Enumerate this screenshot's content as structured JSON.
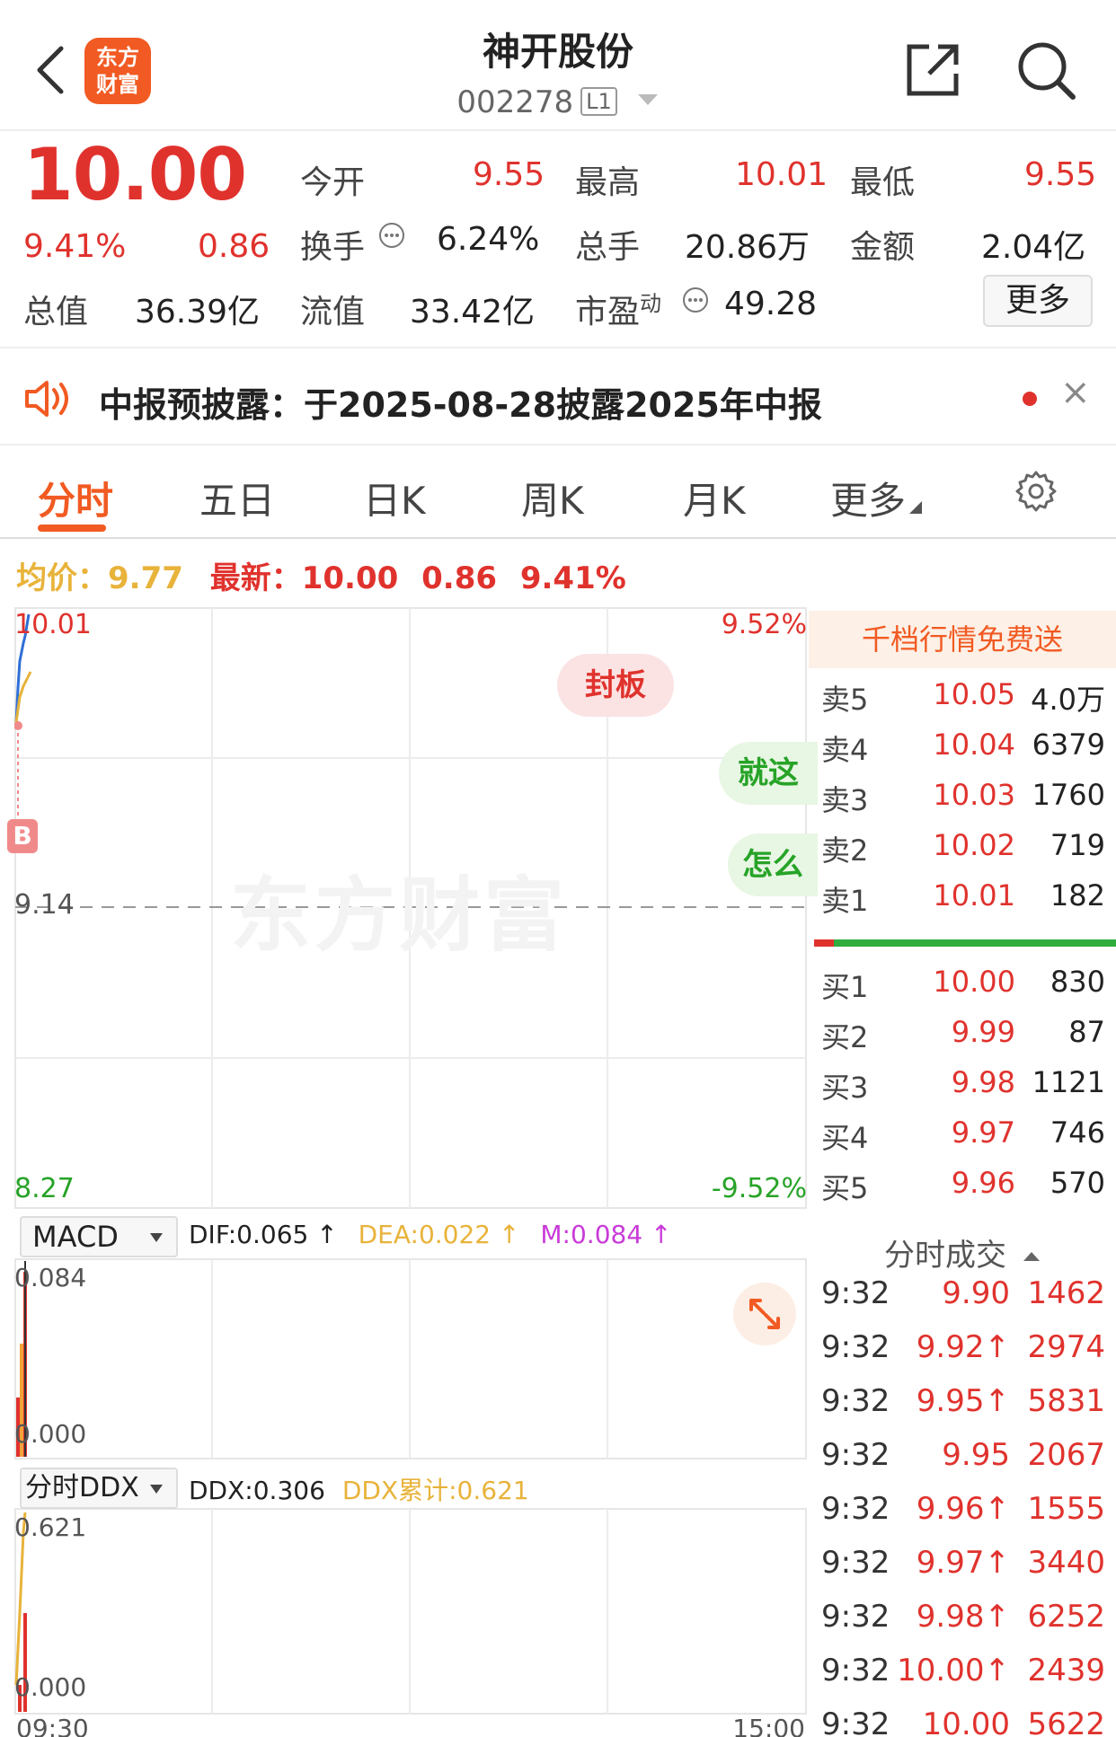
{
  "header": {
    "title": "神开股份",
    "code": "002278",
    "level": "L1",
    "logo_line1": "东方",
    "logo_line2": "财富"
  },
  "quote": {
    "price": "10.00",
    "change_pct": "9.41%",
    "change": "0.86",
    "open_label": "今开",
    "open": "9.55",
    "high_label": "最高",
    "high": "10.01",
    "low_label": "最低",
    "low": "9.55",
    "turnover_label": "换手",
    "turnover": "6.24%",
    "volume_label": "总手",
    "volume": "20.86万",
    "amount_label": "金额",
    "amount": "2.04亿",
    "mktcap_label": "总值",
    "mktcap": "36.39亿",
    "float_label": "流值",
    "float": "33.42亿",
    "pe_label": "市盈",
    "pe_sup": "动",
    "pe": "49.28",
    "more_button": "更多"
  },
  "notice": {
    "text": "中报预披露：于2025-08-28披露2025年中报",
    "close": "×"
  },
  "tabs": [
    {
      "label": "分时"
    },
    {
      "label": "五日"
    },
    {
      "label": "日K"
    },
    {
      "label": "周K"
    },
    {
      "label": "月K"
    },
    {
      "label": "更多"
    }
  ],
  "intraday": {
    "avg_label": "均价：",
    "avg": "9.77",
    "latest_label": "最新：",
    "latest": "10.00",
    "latest_change": "0.86",
    "latest_pct": "9.41%",
    "y_top": "10.01",
    "y_mid": "9.14",
    "y_bottom": "8.27",
    "pct_top": "9.52%",
    "pct_bottom": "-9.52%",
    "badge_limit": "封板",
    "bubble1": "就这",
    "bubble2": "怎么",
    "b_marker": "B",
    "watermark": "东方财富",
    "time_start": "09:30",
    "time_end": "15:00",
    "colors": {
      "price_line": "#2f6fd6",
      "avg_line": "#e8b33a",
      "up": "#e0322d",
      "down": "#27a327"
    }
  },
  "macd": {
    "selector": "MACD",
    "dif": "DIF:0.065 ↑",
    "dea": "DEA:0.022 ↑",
    "m": "M:0.084 ↑",
    "y_top": "0.084",
    "y_bottom": "0.000"
  },
  "ddx": {
    "selector": "分时DDX",
    "ddx": "DDX:0.306",
    "ddx_cum": "DDX累计:0.621",
    "y_top": "0.621",
    "y_bottom": "0.000"
  },
  "book": {
    "promo": "千档行情免费送",
    "asks": [
      {
        "label": "卖5",
        "price": "10.05",
        "vol": "4.0万"
      },
      {
        "label": "卖4",
        "price": "10.04",
        "vol": "6379"
      },
      {
        "label": "卖3",
        "price": "10.03",
        "vol": "1760"
      },
      {
        "label": "卖2",
        "price": "10.02",
        "vol": "719"
      },
      {
        "label": "卖1",
        "price": "10.01",
        "vol": "182"
      }
    ],
    "bids": [
      {
        "label": "买1",
        "price": "10.00",
        "vol": "830"
      },
      {
        "label": "买2",
        "price": "9.99",
        "vol": "87"
      },
      {
        "label": "买3",
        "price": "9.98",
        "vol": "1121"
      },
      {
        "label": "买4",
        "price": "9.97",
        "vol": "746"
      },
      {
        "label": "买5",
        "price": "9.96",
        "vol": "570"
      }
    ],
    "trades_title": "分时成交",
    "trades": [
      {
        "time": "9:32",
        "price": "9.90",
        "vol": "1462"
      },
      {
        "time": "9:32",
        "price": "9.92↑",
        "vol": "2974"
      },
      {
        "time": "9:32",
        "price": "9.95↑",
        "vol": "5831"
      },
      {
        "time": "9:32",
        "price": "9.95",
        "vol": "2067"
      },
      {
        "time": "9:32",
        "price": "9.96↑",
        "vol": "1555"
      },
      {
        "time": "9:32",
        "price": "9.97↑",
        "vol": "3440"
      },
      {
        "time": "9:32",
        "price": "9.98↑",
        "vol": "6252"
      },
      {
        "time": "9:32",
        "price": "10.00↑",
        "vol": "2439"
      },
      {
        "time": "9:32",
        "price": "10.00",
        "vol": "5622"
      }
    ]
  }
}
